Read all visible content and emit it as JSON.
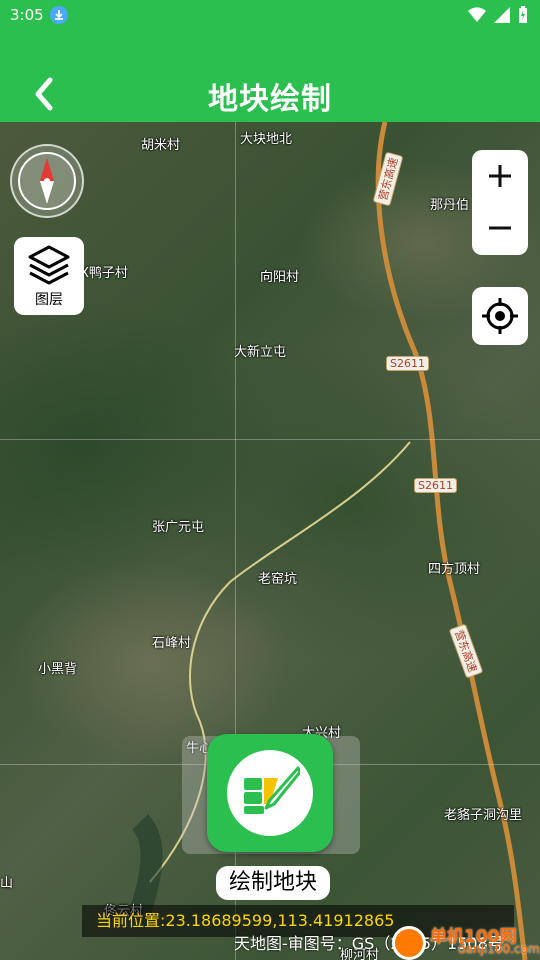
{
  "status_bar": {
    "time": "3:05"
  },
  "header": {
    "title": "地块绘制"
  },
  "map": {
    "places": [
      {
        "name": "胡米村"
      },
      {
        "name": "大块地北"
      },
      {
        "name": "那丹伯"
      },
      {
        "name": "X鸭子村"
      },
      {
        "name": "向阳村"
      },
      {
        "name": "大新立屯"
      },
      {
        "name": "张广元屯"
      },
      {
        "name": "老窑坑"
      },
      {
        "name": "四方顶村"
      },
      {
        "name": "石峰村"
      },
      {
        "name": "小黑背"
      },
      {
        "name": "牛心"
      },
      {
        "name": "大兴村"
      },
      {
        "name": "老貉子洞沟里"
      },
      {
        "name": "柳河村"
      },
      {
        "name": "佟云村"
      },
      {
        "name": "山"
      }
    ],
    "road_labels": [
      "S2611",
      "S2611"
    ],
    "highway_labels": [
      "营东高速",
      "营东高速"
    ]
  },
  "controls": {
    "layer_label": "图层",
    "draw_label": "绘制地块"
  },
  "position": {
    "text": "当前位置:23.18689599,113.41912865"
  },
  "attribution": "天地图-审图号：GS（2025）1508号",
  "watermark": {
    "name": "单机100网",
    "sub": "danji100.com"
  },
  "colors": {
    "primary": "#2bbf4f",
    "position_text": "#ffd400"
  }
}
